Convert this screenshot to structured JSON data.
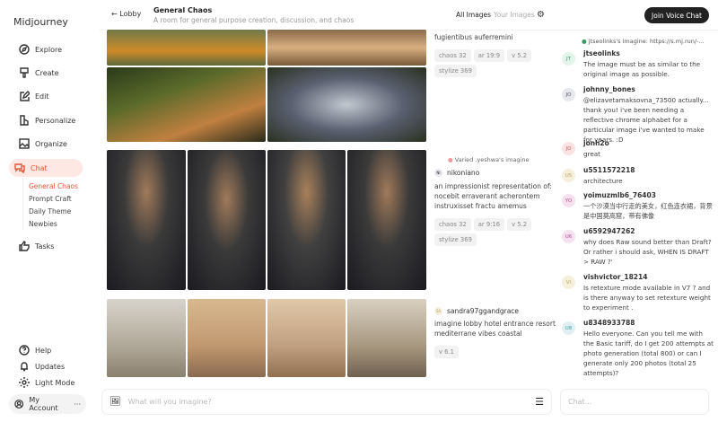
{
  "app": {
    "title": "Midjourney"
  },
  "sidebar": {
    "items": [
      {
        "label": "Explore"
      },
      {
        "label": "Create"
      },
      {
        "label": "Edit"
      },
      {
        "label": "Personalize"
      },
      {
        "label": "Organize"
      },
      {
        "label": "Chat"
      },
      {
        "label": "Tasks"
      }
    ],
    "chat_rooms": [
      "General Chaos",
      "Prompt Craft",
      "Daily Theme",
      "Newbies"
    ],
    "bottom": [
      {
        "label": "Help"
      },
      {
        "label": "Updates"
      },
      {
        "label": "Light Mode"
      },
      {
        "label": "My Account"
      }
    ],
    "more": "···"
  },
  "header": {
    "back": "Lobby",
    "title": "General Chaos",
    "subtitle": "A room for general purpose creation, discussion, and chaos",
    "tabs": [
      "All Images",
      "Your Images"
    ],
    "voice": "Join Voice Chat"
  },
  "feed": [
    {
      "prompt": "fugientibus auferremini",
      "tags": [
        "chaos 32",
        "ar 19:9",
        "v 5.2",
        "stylize 369"
      ]
    },
    {
      "reply": "Varied .yeshwa's imagine",
      "user": "nikoniano",
      "prompt": "an impressionist representation of: nocebit erraverant acherontem instruxisset fractu amemus",
      "tags": [
        "chaos 32",
        "ar 9:16",
        "v 5.2",
        "stylize 369"
      ]
    },
    {
      "user": "sandra97ggandgrace",
      "prompt": "imagine lobby hotel entrance resort mediterrane vibes coastal",
      "tags": [
        "v 6.1"
      ]
    }
  ],
  "chat": {
    "reply": "jtseolinks's imagine: https://s.mj.run/-...",
    "messages": [
      {
        "initials": "JT",
        "user": "jtseolinks",
        "text": "The image must be as similar to the original image as possible.",
        "color": "#e3f4ea",
        "fg": "#3a9a64"
      },
      {
        "initials": "JO",
        "user": "johnny_bones",
        "text": "@elizavetamaksovna_73500 actually... thank you! i've been needing a reflective chrome alphabet for a particular image i've wanted to make for years. :D",
        "color": "#e6e8ee",
        "fg": "#556"
      },
      {
        "initials": "JO",
        "user": "jonh2o",
        "text": "great",
        "color": "#fbe3e3",
        "fg": "#c55"
      },
      {
        "initials": "U5",
        "user": "u5511572218",
        "text": "architecture",
        "color": "#f6efdc",
        "fg": "#b9a060"
      },
      {
        "initials": "YO",
        "user": "yoimuzmlb6_76403",
        "text": "一个沙漠当中行走的美女，红色连衣裙，背景是中国莫高窟，带有佛像",
        "color": "#f8e1ef",
        "fg": "#c4508f"
      },
      {
        "initials": "U6",
        "user": "u6592947262",
        "text": "why does Raw sound better than Draft? Or rather i should ask, WHEN IS DRAFT > RAW ?'",
        "color": "#f6e1f0",
        "fg": "#b0509a"
      },
      {
        "initials": "VI",
        "user": "vishvictor_18214",
        "text": "Is retexture mode available in V7 ? and is there anyway to set retexture weight to experiment .",
        "color": "#f6efdc",
        "fg": "#b9a060"
      },
      {
        "initials": "U8",
        "user": "u8348933788",
        "text": "Hello everyone. Can you tell me with the Basic tariff, do I get 200 attempts at photo generation (total 800) or can I generate only 200 photos (total 25 attempts)?",
        "color": "#e0f0f2",
        "fg": "#3a9aa8"
      }
    ]
  },
  "input": {
    "placeholder": "What will you imagine?",
    "chat_placeholder": "Chat..."
  }
}
